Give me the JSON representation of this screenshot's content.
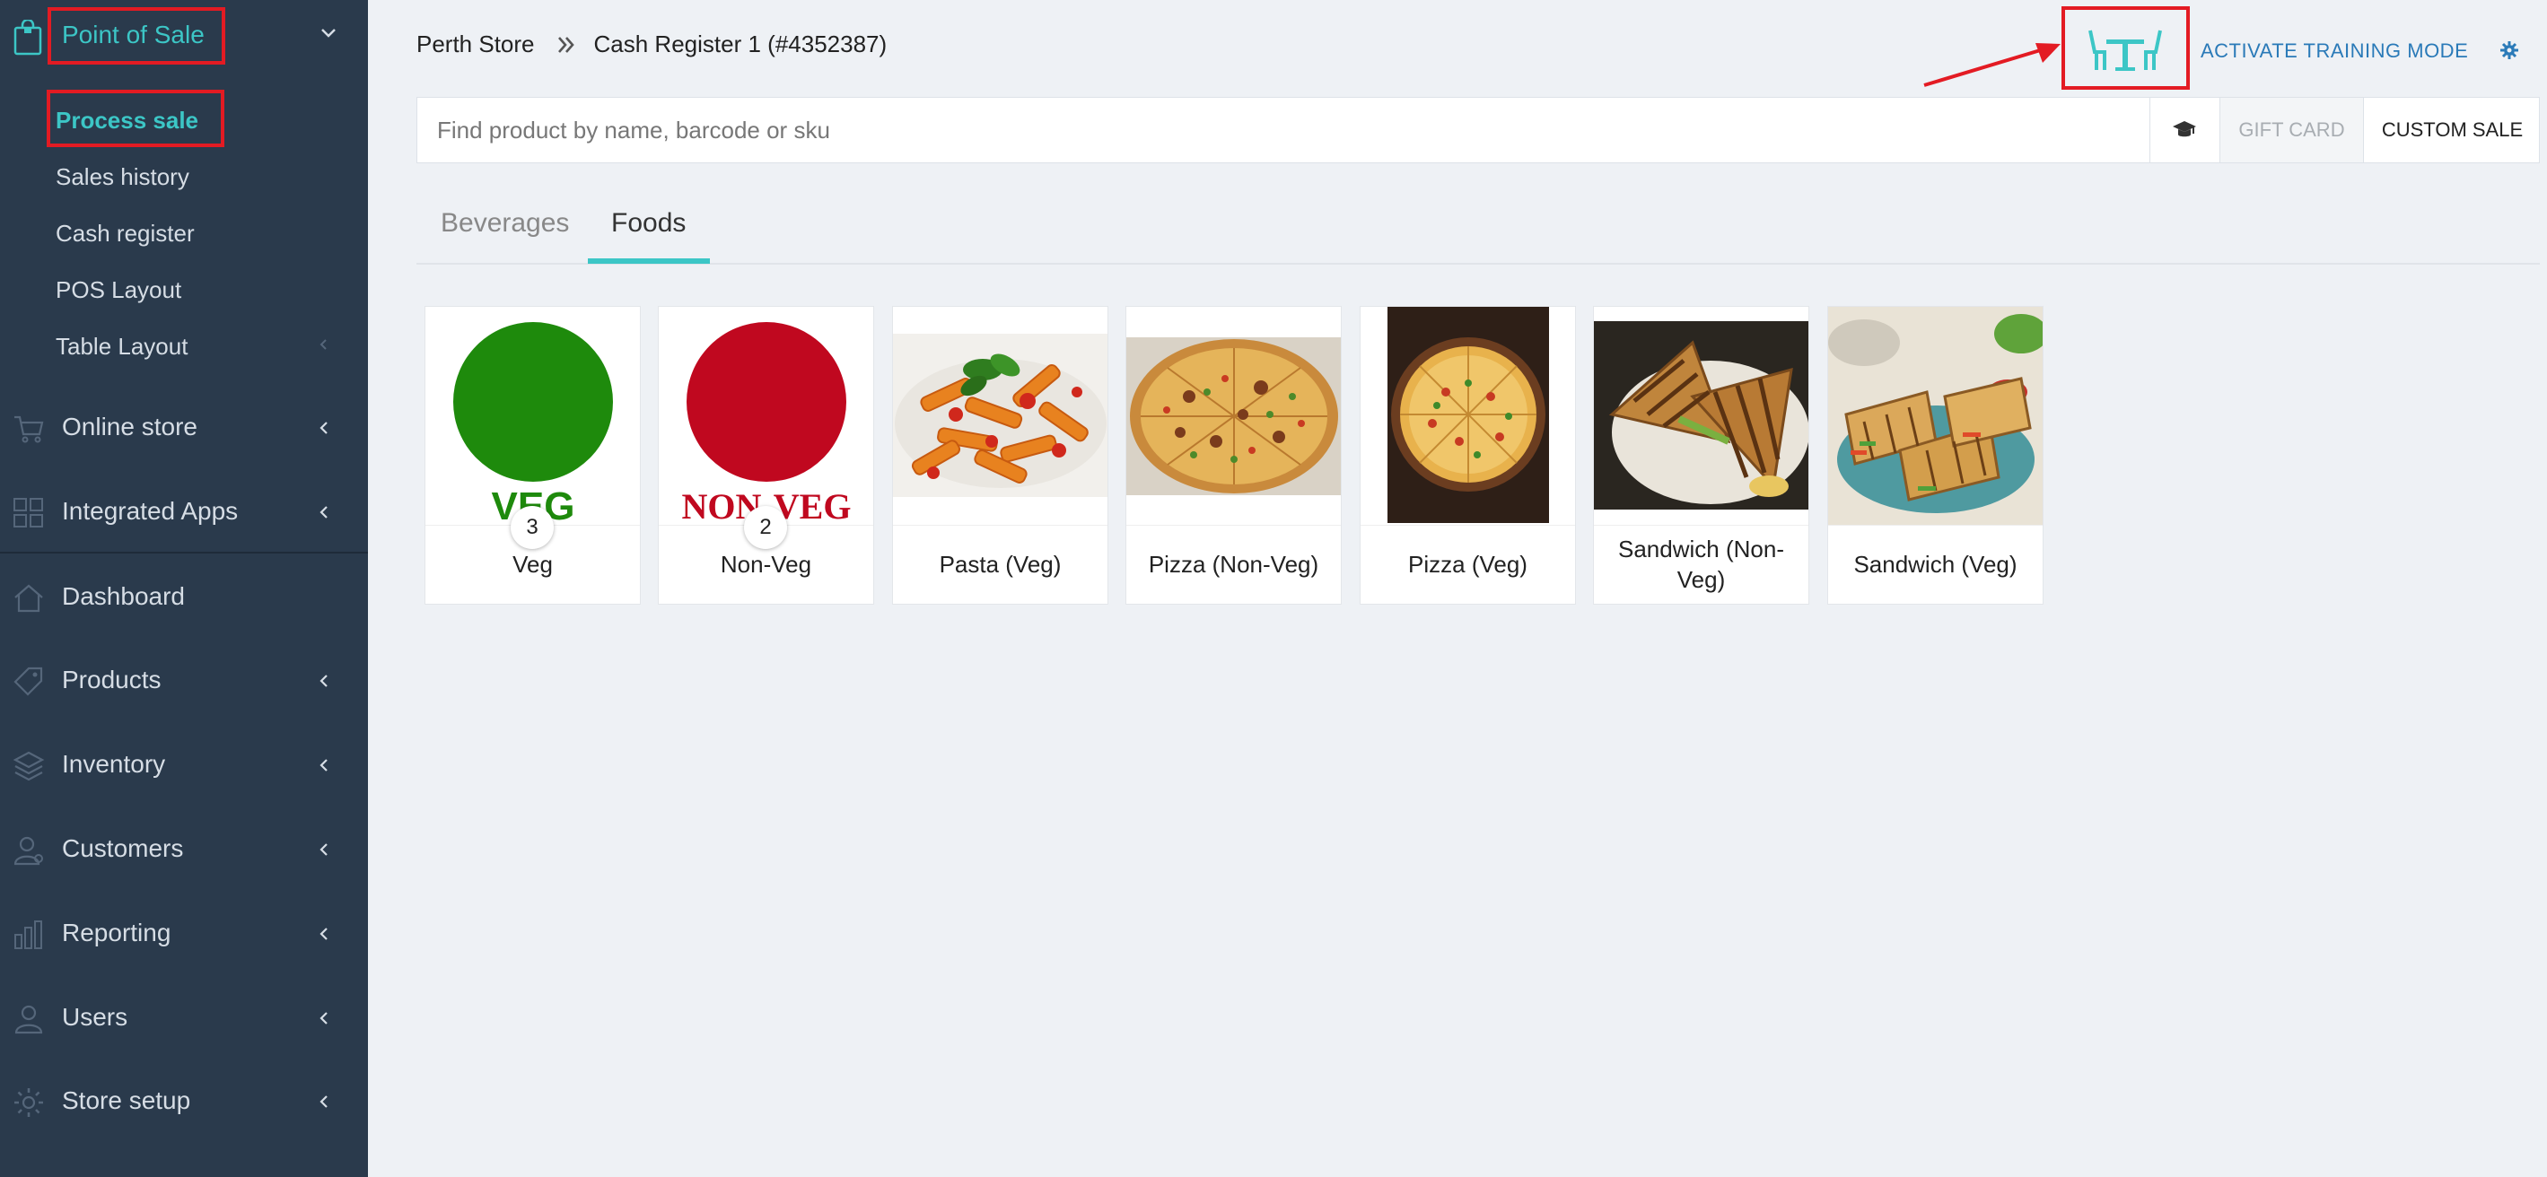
{
  "sidebar": {
    "pos_title": "Point of Sale",
    "sub_items": [
      {
        "label": "Process sale"
      },
      {
        "label": "Sales history"
      },
      {
        "label": "Cash register"
      },
      {
        "label": "POS Layout"
      },
      {
        "label": "Table Layout"
      }
    ],
    "nav_items": [
      {
        "label": "Online store",
        "icon": "cart-icon"
      },
      {
        "label": "Integrated Apps",
        "icon": "grid-icon"
      },
      {
        "label": "Dashboard",
        "icon": "home-icon"
      },
      {
        "label": "Products",
        "icon": "tag-icon"
      },
      {
        "label": "Inventory",
        "icon": "layers-icon"
      },
      {
        "label": "Customers",
        "icon": "person-icon"
      },
      {
        "label": "Reporting",
        "icon": "bar-chart-icon"
      },
      {
        "label": "Users",
        "icon": "user-icon"
      },
      {
        "label": "Store setup",
        "icon": "gear-icon"
      }
    ]
  },
  "header": {
    "store": "Perth Store",
    "register": "Cash Register 1 (#4352387)",
    "training_label": "ACTIVATE TRAINING MODE"
  },
  "search": {
    "placeholder": "Find product by name, barcode or sku",
    "gift_card": "GIFT CARD",
    "custom_sale": "CUSTOM SALE"
  },
  "tabs": [
    {
      "label": "Beverages",
      "active": false
    },
    {
      "label": "Foods",
      "active": true
    }
  ],
  "products": [
    {
      "name": "Veg",
      "count": "3",
      "image_text": "VEG"
    },
    {
      "name": "Non-Veg",
      "count": "2",
      "image_text": "NON-VEG"
    },
    {
      "name": "Pasta (Veg)"
    },
    {
      "name": "Pizza (Non-Veg)"
    },
    {
      "name": "Pizza (Veg)"
    },
    {
      "name": "Sandwich (Non-Veg)"
    },
    {
      "name": "Sandwich (Veg)"
    }
  ],
  "colors": {
    "accent": "#3cc6c6",
    "sidebar_bg": "#2a3a4c",
    "highlight_red": "#e31b23",
    "veg_green": "#1e8a0c",
    "nonveg_red": "#c0081f"
  }
}
